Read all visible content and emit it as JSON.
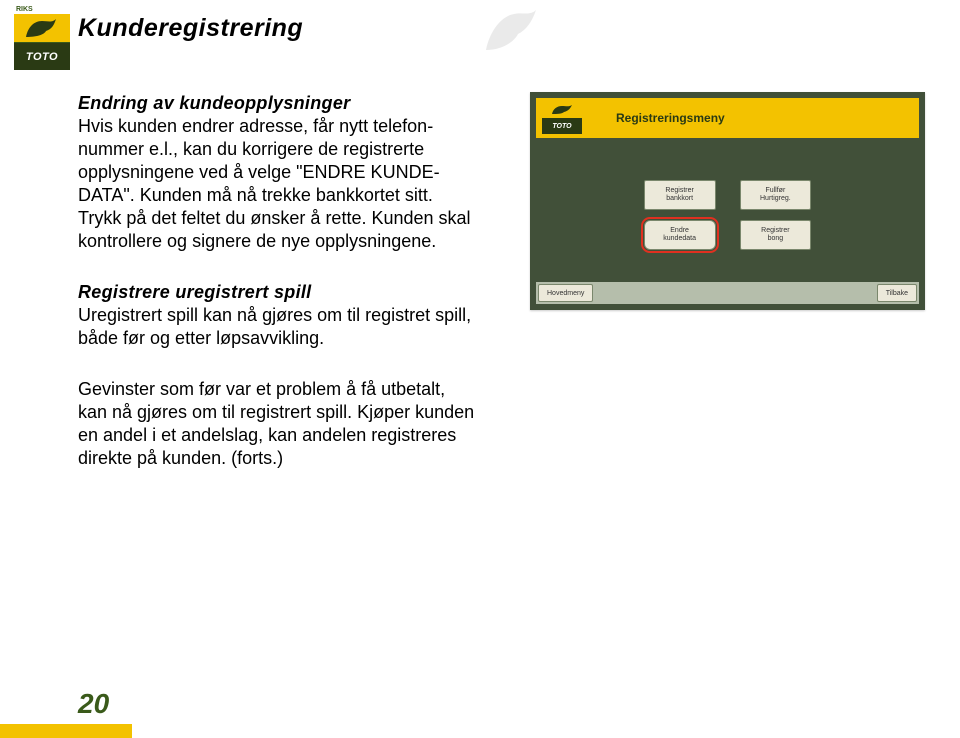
{
  "logo": {
    "top_label": "RIKS",
    "bottom_label": "TOTO"
  },
  "page_title": "Kunderegistrering",
  "section1": {
    "heading": "Endring av kundeopplysninger",
    "body": "Hvis kunden endrer adresse, får nytt telefon­nummer e.l., kan du korrigere de registrerte opplysningene ved å velge \"ENDRE KUNDE­DATA\". Kunden må nå trekke bankkortet sitt. Trykk på det feltet du ønsker å rette. Kunden skal kontrollere og signere de nye opplysningene."
  },
  "section2": {
    "heading": "Registrere uregistrert spill",
    "body1": "Uregistrert spill kan nå gjøres om til registret spill, både før og etter løpsavvikling.",
    "body2": "Gevinster som før var et problem å få ut­betalt, kan nå gjøres om til registrert spill. Kjøper kunden en andel i et andelslag, kan andelen registreres direkte på kunden. (forts.)"
  },
  "screenshot": {
    "title": "Registreringsmeny",
    "mini_logo": "TOTO",
    "buttons": {
      "r1c1": "Registrer\nbankkort",
      "r1c2": "Fullfør\nHurtigreg.",
      "r2c1": "Endre\nkundedata",
      "r2c2": "Registrer\nbong"
    },
    "bottom": {
      "left": "Hovedmeny",
      "right": "Tilbake"
    }
  },
  "page_number": "20"
}
